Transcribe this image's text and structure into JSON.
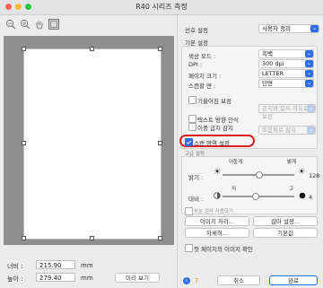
{
  "window": {
    "title": "R40 시리즈 측정"
  },
  "dimensions": {
    "width_label": "너비 :",
    "width_value": "215.90",
    "height_label": "높이 :",
    "height_value": "279.40",
    "unit": "mm",
    "preview_button": "미리 보기"
  },
  "settings": {
    "preference_label": "선호 설정",
    "preference_value": "사용자 정의",
    "basic_label": "기본 설정",
    "color_mode_label": "색상 모드 :",
    "color_mode_value": "흑백",
    "dpi_label": "DPI :",
    "dpi_value": "300 dpi",
    "page_size_label": "페이지 크기 :",
    "page_size_value": "LETTER",
    "scan_side_label": "스캔할 면 :",
    "scan_side_value": "단면",
    "deskew_label": "기울어짐 보정",
    "auto_crop_value": "공지와 문서 자도로 보정",
    "text_orientation_label": "텍스트 방향 인식",
    "double_feed_label": "이중 급지 감지",
    "double_feed_value": "초음파로 감지",
    "scan_area_label": "스캔 영역 설정",
    "adjust_label": "고급 설정"
  },
  "adjustments": {
    "brightness_label": "밝기 :",
    "brightness_low": "어둡게",
    "brightness_high": "밝게",
    "brightness_value": "128",
    "brightness_level": 0.5,
    "contrast_label": "대비 :",
    "contrast_low": "저",
    "contrast_high": "고",
    "contrast_value": "4",
    "contrast_level": 0.45,
    "partial_label": "부분 검사 사용하기"
  },
  "buttons": {
    "image_process": "이미지 처리...",
    "drop_out": "감마 설정...",
    "details": "자세히...",
    "defaults": "기본값",
    "first_page_label": "첫 페이지의 이미지 확인",
    "cancel": "취소",
    "done": "완료"
  },
  "colors": {
    "accent": "#2f6ee6",
    "highlight_ring": "#e0201c"
  }
}
